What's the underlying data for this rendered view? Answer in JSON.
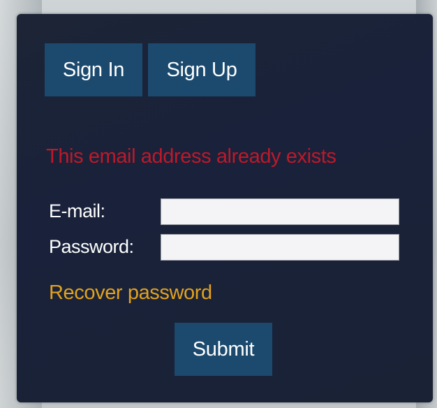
{
  "tabs": {
    "sign_in": "Sign In",
    "sign_up": "Sign Up"
  },
  "error": {
    "message": "This email address already exists",
    "color": "#c0182a"
  },
  "form": {
    "email_label": "E-mail:",
    "email_value": "",
    "password_label": "Password:",
    "password_value": ""
  },
  "recover": {
    "label": "Recover password",
    "color": "#e3a21d"
  },
  "submit": {
    "label": "Submit"
  },
  "colors": {
    "panel": "#1a2236",
    "button": "#1b4a6e"
  }
}
